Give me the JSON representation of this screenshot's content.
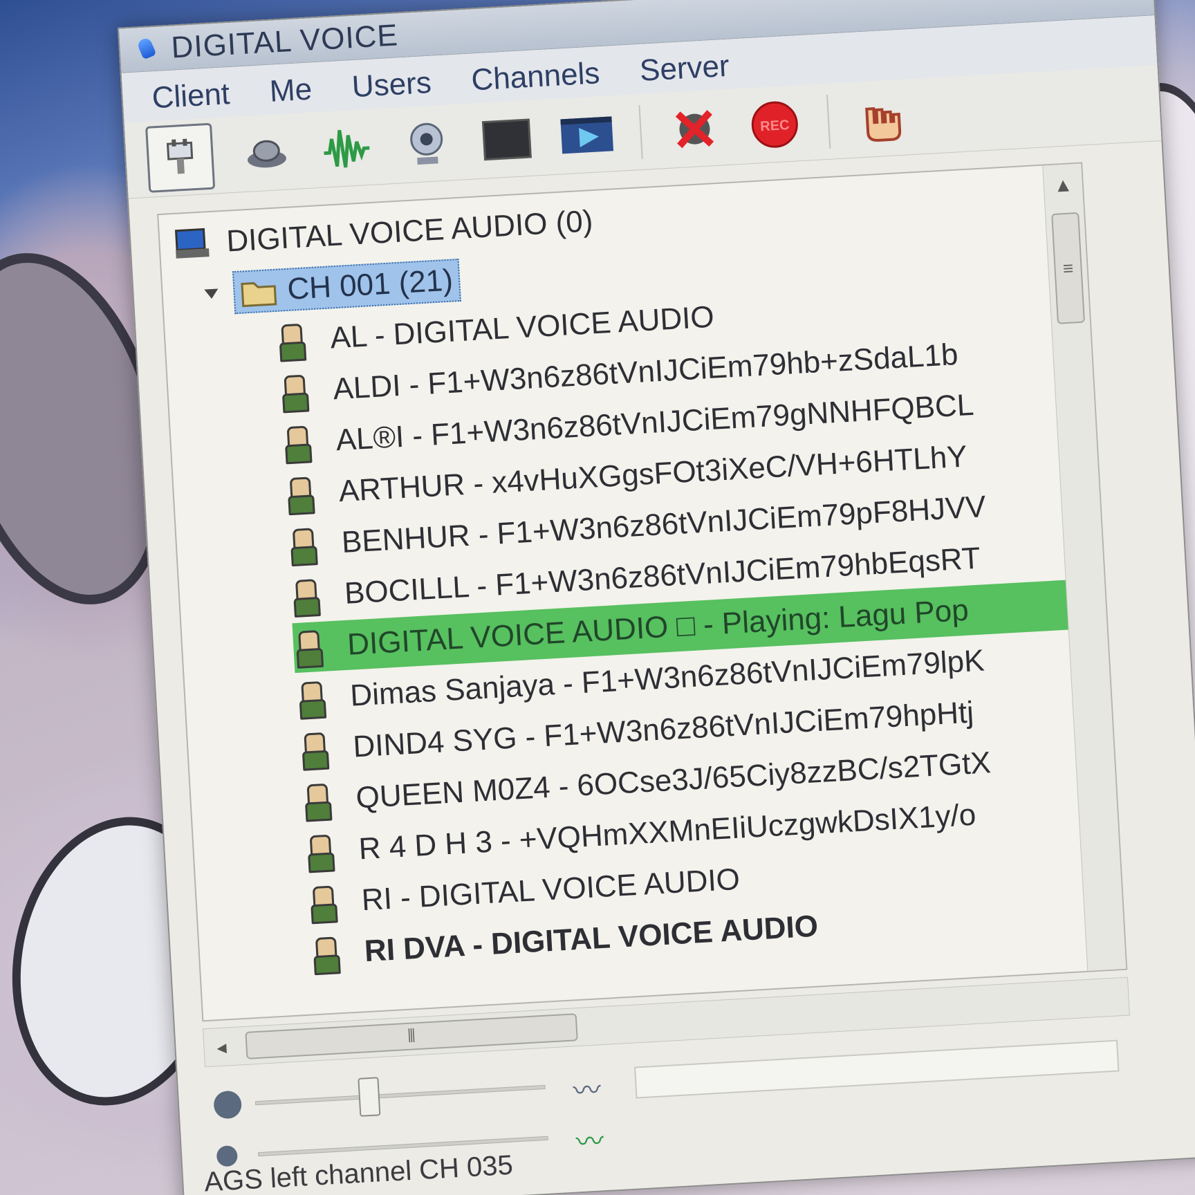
{
  "window": {
    "title": "DIGITAL VOICE"
  },
  "menu": [
    "Client",
    "Me",
    "Users",
    "Channels",
    "Server"
  ],
  "toolbar": [
    {
      "icon": "connect-icon"
    },
    {
      "icon": "headset-icon"
    },
    {
      "icon": "voice-activation-icon"
    },
    {
      "icon": "webcam-icon"
    },
    {
      "icon": "desktop-share-icon"
    },
    {
      "icon": "media-stream-icon"
    },
    {
      "icon": "stop-stream-icon"
    },
    {
      "icon": "record-icon",
      "label": "REC"
    },
    {
      "icon": "hand-icon"
    }
  ],
  "tree": {
    "server": "DIGITAL VOICE AUDIO (0)",
    "channel": "CH 001 (21)",
    "users": [
      "AL - DIGITAL VOICE AUDIO",
      "ALDI - F1+W3n6z86tVnIJCiEm79hb+zSdaL1b",
      "AL®I - F1+W3n6z86tVnIJCiEm79gNNHFQBCL",
      "ARTHUR - x4vHuXGgsFOt3iXeC/VH+6HTLhY",
      "BENHUR - F1+W3n6z86tVnIJCiEm79pF8HJVV",
      "BOCILLL - F1+W3n6z86tVnIJCiEm79hbEqsRT",
      "DIGITAL VOICE AUDIO □ - Playing: Lagu Pop",
      "Dimas Sanjaya - F1+W3n6z86tVnIJCiEm79lpK",
      "DIND4 SYG - F1+W3n6z86tVnIJCiEm79hpHtj",
      "QUEEN M0Z4 - 6OCse3J/65Ciy8zzBC/s2TGtX",
      "R 4 D H 3 - +VQHmXXMnEIiUczgwkDsIX1y/o",
      "RI - DIGITAL VOICE AUDIO",
      "RI DVA - DIGITAL VOICE AUDIO"
    ]
  },
  "colors": {
    "highlight": "#57c05f",
    "channel_selection": "#9fc3ea"
  },
  "status": "AGS left channel CH 035"
}
